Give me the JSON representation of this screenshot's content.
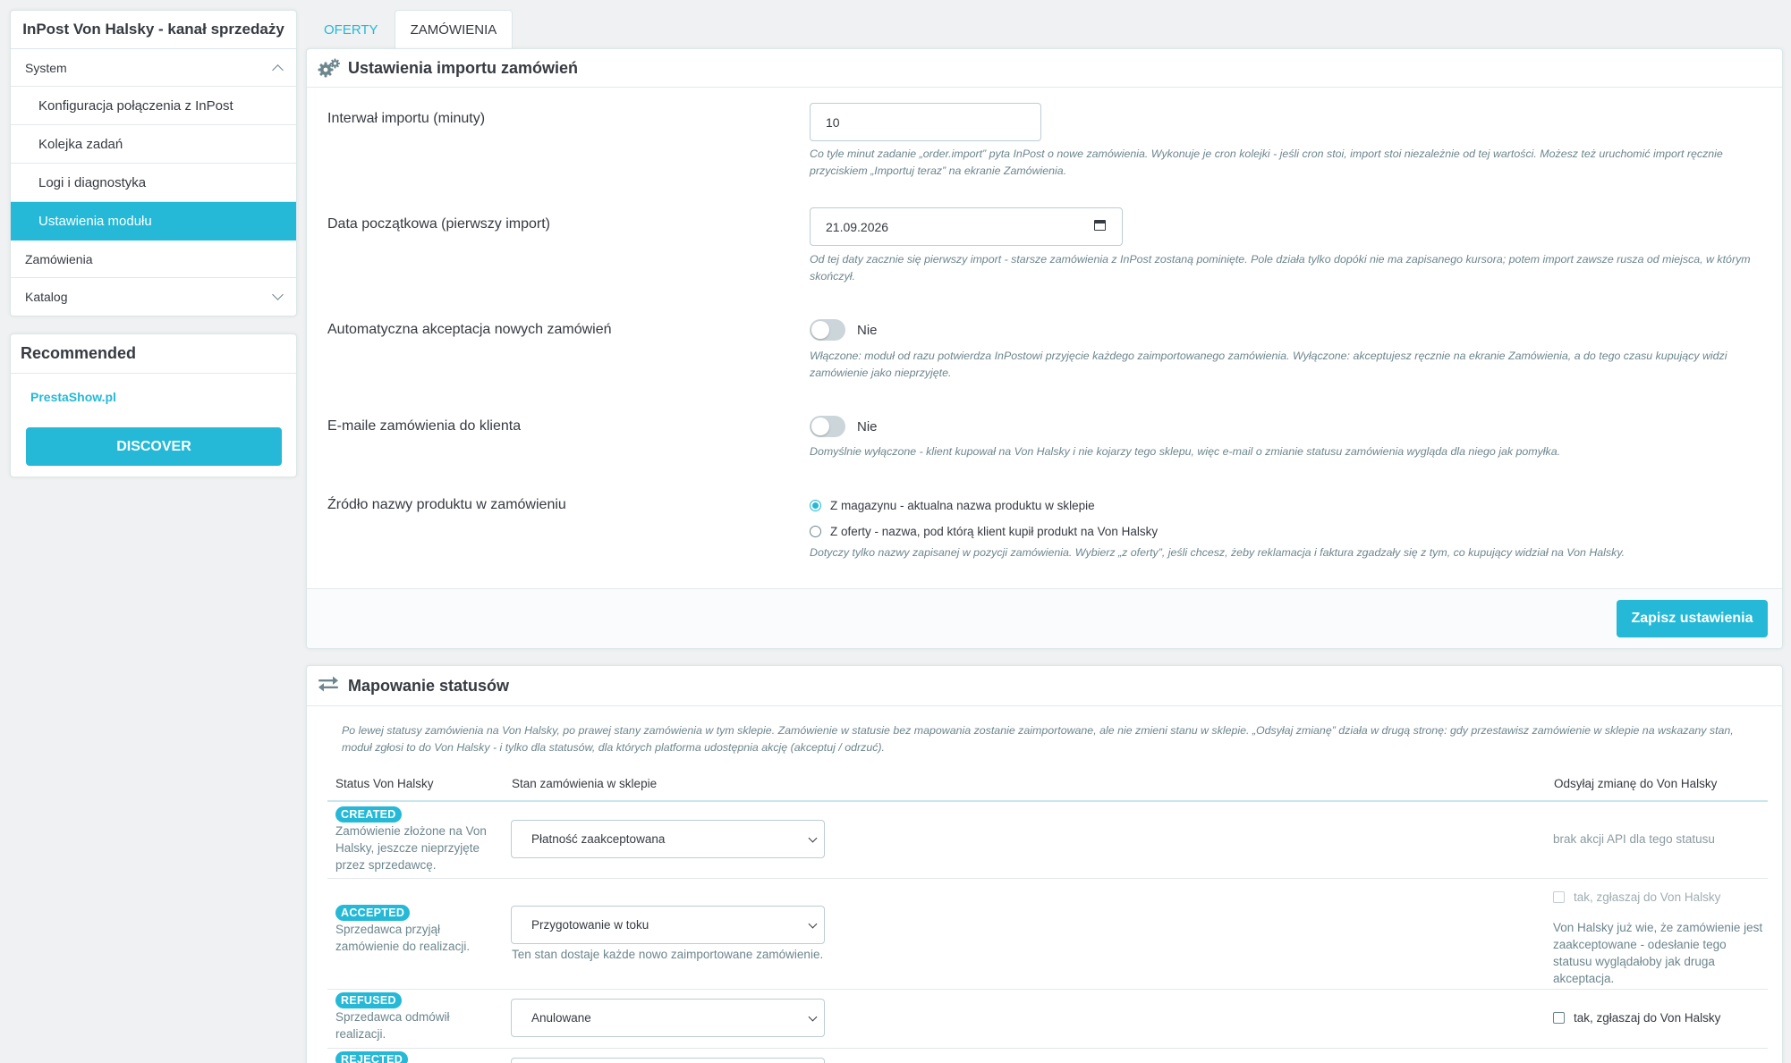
{
  "sidebar": {
    "title": "InPost Von Halsky - kanał sprzedaży",
    "groups": [
      {
        "label": "System"
      },
      {
        "label": "Zamówienia"
      },
      {
        "label": "Katalog"
      }
    ],
    "system_items": [
      {
        "label": "Konfiguracja połączenia z InPost"
      },
      {
        "label": "Kolejka zadań"
      },
      {
        "label": "Logi i diagnostyka"
      },
      {
        "label": "Ustawienia modułu"
      }
    ],
    "recommended": {
      "title": "Recommended",
      "link": "PrestaShow.pl",
      "button": "DISCOVER"
    }
  },
  "tabs": [
    {
      "label": "OFERTY"
    },
    {
      "label": "ZAMÓWIENIA"
    }
  ],
  "import_panel": {
    "title": "Ustawienia importu zamówień",
    "interval": {
      "label": "Interwał importu (minuty)",
      "value": "10",
      "help": "Co tyle minut zadanie „order.import” pyta InPost o nowe zamówienia. Wykonuje je cron kolejki - jeśli cron stoi, import stoi niezależnie od tej wartości. Możesz też uruchomić import ręcznie przyciskiem „Importuj teraz” na ekranie Zamówienia."
    },
    "start_date": {
      "label": "Data początkowa (pierwszy import)",
      "value": "21.09.2026",
      "help": "Od tej daty zacznie się pierwszy import - starsze zamówienia z InPost zostaną pominięte. Pole działa tylko dopóki nie ma zapisanego kursora; potem import zawsze rusza od miejsca, w którym skończył."
    },
    "auto_accept": {
      "label": "Automatyczna akceptacja nowych zamówień",
      "state": "Nie",
      "help": "Włączone: moduł od razu potwierdza InPostowi przyjęcie każdego zaimportowanego zamówienia. Wyłączone: akceptujesz ręcznie na ekranie Zamówienia, a do tego czasu kupujący widzi zamówienie jako nieprzyjęte."
    },
    "emails": {
      "label": "E-maile zamówienia do klienta",
      "state": "Nie",
      "help": "Domyślnie wyłączone - klient kupował na Von Halsky i nie kojarzy tego sklepu, więc e-mail o zmianie statusu zamówienia wygląda dla niego jak pomyłka."
    },
    "name_source": {
      "label": "Źródło nazwy produktu w zamówieniu",
      "options": [
        {
          "label": "Z magazynu - aktualna nazwa produktu w sklepie",
          "selected": true
        },
        {
          "label": "Z oferty - nazwa, pod którą klient kupił produkt na Von Halsky",
          "selected": false
        }
      ],
      "help": "Dotyczy tylko nazwy zapisanej w pozycji zamówienia. Wybierz „z oferty”, jeśli chcesz, żeby reklamacja i faktura zgadzały się z tym, co kupujący widział na Von Halsky."
    },
    "save_button": "Zapisz ustawienia"
  },
  "mapping_panel": {
    "title": "Mapowanie statusów",
    "intro": "Po lewej statusy zamówienia na Von Halsky, po prawej stany zamówienia w tym sklepie. Zamówienie w statusie bez mapowania zostanie zaimportowane, ale nie zmieni stanu w sklepie. „Odsyłaj zmianę” działa w drugą stronę: gdy przestawisz zamówienie w sklepie na wskazany stan, moduł zgłosi to do Von Halsky - i tylko dla statusów, dla których platforma udostępnia akcję (akceptuj / odrzuć).",
    "columns": [
      "Status Von Halsky",
      "Stan zamówienia w sklepie",
      "Odsyłaj zmianę do Von Halsky"
    ],
    "rows": [
      {
        "badge": "CREATED",
        "desc": "Zamówienie złożone na Von Halsky, jeszcze nieprzyjęte przez sprzedawcę.",
        "state": "Płatność zaakceptowana",
        "note": "",
        "sync_text": "brak akcji API dla tego statusu"
      },
      {
        "badge": "ACCEPTED",
        "desc": "Sprzedawca przyjął zamówienie do realizacji.",
        "state": "Przygotowanie w toku",
        "note": "Ten stan dostaje każde nowo zaimportowane zamówienie.",
        "sync_label": "tak, zgłaszaj do Von Halsky",
        "sync_text": "Von Halsky już wie, że zamówienie jest zaakceptowane - odesłanie tego statusu wyglądałoby jak druga akceptacja."
      },
      {
        "badge": "REFUSED",
        "desc": "Sprzedawca odmówił realizacji.",
        "state": "Anulowane",
        "note": "",
        "sync_label": "tak, zgłaszaj do Von Halsky"
      },
      {
        "badge": "REJECTED",
        "desc": "",
        "state": "",
        "note": ""
      }
    ]
  },
  "colors": {
    "accent": "#25b9d7",
    "text": "#363a41",
    "muted": "#6c868e",
    "background": "#eff1f2"
  }
}
